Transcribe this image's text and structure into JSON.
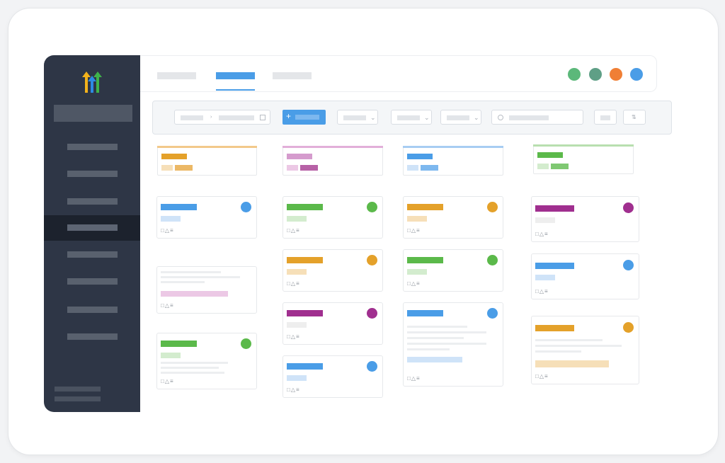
{
  "colors": {
    "sidebar": "#2e3646",
    "accent_blue": "#4a9de7",
    "orange": "#e4a12a",
    "pink": "#d59bcd",
    "green": "#5bb94a",
    "purple": "#a02f8f"
  },
  "logo": {
    "icon": "arrows-logo-icon"
  },
  "header": {
    "status_dots": [
      {
        "color": "#5cb87a"
      },
      {
        "color": "#5f9f86"
      },
      {
        "color": "#f07f35"
      },
      {
        "color": "#4a9de7"
      }
    ]
  },
  "toolbar": {
    "add_label": "+"
  },
  "card_icons": "□△≡"
}
